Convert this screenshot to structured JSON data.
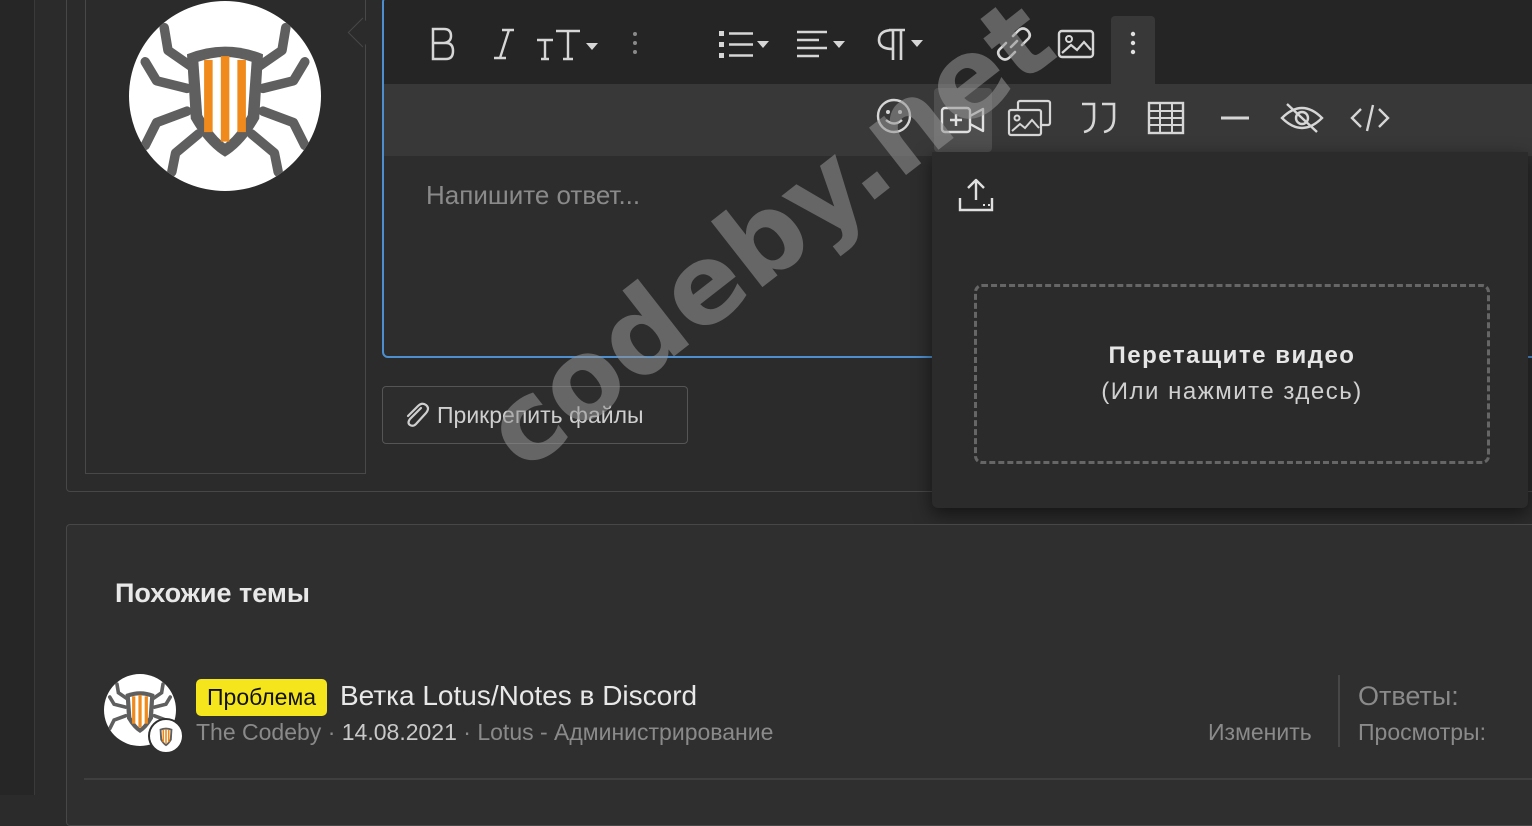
{
  "colors": {
    "background": "#2b2b2b",
    "editor_focus_border": "#4c8ecf",
    "badge_bg": "#f5e51c",
    "logo_orange": "#f08a1c",
    "logo_gray": "#5f5f5f"
  },
  "editor": {
    "placeholder": "Напишите ответ...",
    "toolbar_row1": [
      "bold-icon",
      "italic-icon",
      "text-size-icon",
      "vertical-dots-icon",
      "list-icon",
      "align-icon",
      "paragraph-icon",
      "link-icon",
      "image-icon",
      "more-options-icon"
    ],
    "toolbar_row2": [
      "smiley-icon",
      "video-insert-icon",
      "gallery-icon",
      "quote-icon",
      "table-icon",
      "horizontal-line-icon",
      "hide-content-icon",
      "code-icon"
    ]
  },
  "attach": {
    "label": "Прикрепить файлы"
  },
  "video_popup": {
    "drop_title": "Перетащите видео",
    "drop_hint": "(Или нажмите здесь)"
  },
  "watermark": {
    "text": "codeby.net"
  },
  "similar": {
    "title": "Похожие темы",
    "threads": [
      {
        "badge": "Проблема",
        "title": "Ветка Lotus/Notes в Discord",
        "author": "The Codeby",
        "date": "14.08.2021",
        "forum": "Lotus - Администрирование",
        "edit": "Изменить",
        "replies_label": "Ответы:",
        "views_label": "Просмотры:"
      }
    ]
  }
}
